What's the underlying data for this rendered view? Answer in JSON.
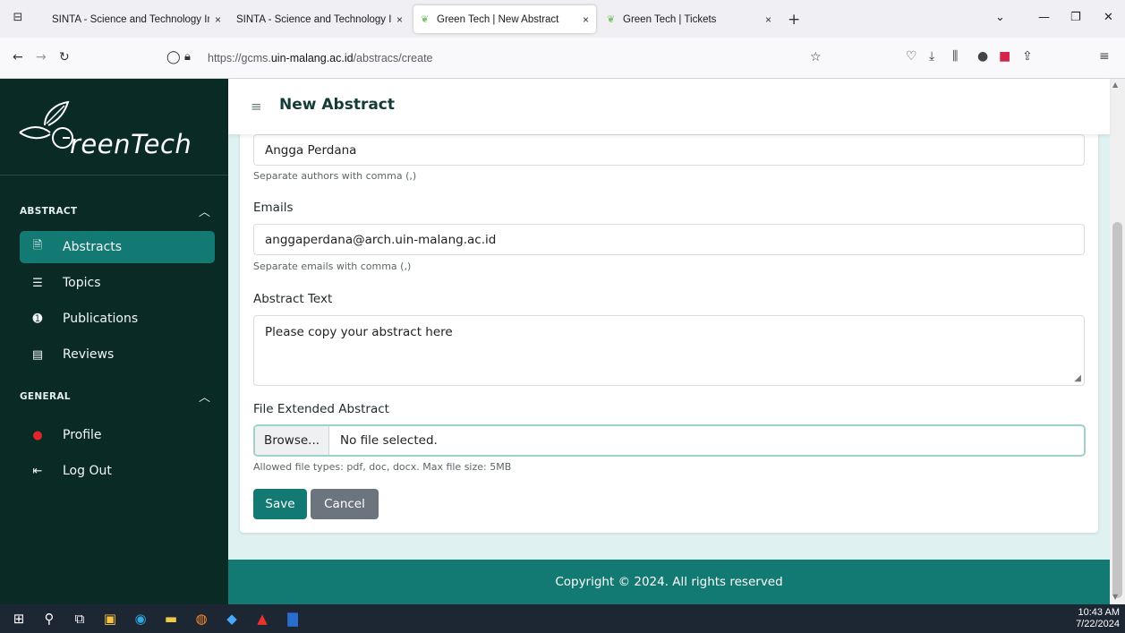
{
  "browser": {
    "tabs": [
      {
        "title": "SINTA - Science and Technology Ind",
        "active": false
      },
      {
        "title": "SINTA - Science and Technology Ind",
        "active": false
      },
      {
        "title": "Green Tech | New Abstract",
        "active": true
      },
      {
        "title": "Green Tech | Tickets",
        "active": false
      }
    ],
    "close_glyph": "×",
    "new_tab_glyph": "+",
    "url_prefix": "https://gcms.",
    "url_domain": "uin-malang.ac.id",
    "url_path": "/abstracs/create"
  },
  "sidebar": {
    "logo_text": "reenTech",
    "sections": [
      {
        "label": "ABSTRACT",
        "items": [
          {
            "label": "Abstracts",
            "icon": "document-icon",
            "active": true
          },
          {
            "label": "Topics",
            "icon": "list-icon",
            "active": false
          },
          {
            "label": "Publications",
            "icon": "upload-circle-icon",
            "active": false
          },
          {
            "label": "Reviews",
            "icon": "message-icon",
            "active": false
          }
        ]
      },
      {
        "label": "GENERAL",
        "items": [
          {
            "label": "Profile",
            "icon": "alert-circle-icon",
            "active": false
          },
          {
            "label": "Log Out",
            "icon": "logout-icon",
            "active": false
          }
        ]
      }
    ]
  },
  "header": {
    "title": "New Abstract"
  },
  "form": {
    "authors_value": "Angga Perdana",
    "authors_help": "Separate authors with comma (,)",
    "emails_label": "Emails",
    "emails_value": "anggaperdana@arch.uin-malang.ac.id",
    "emails_help": "Separate emails with comma (,)",
    "abstract_label": "Abstract Text",
    "abstract_placeholder": "Please copy your abstract here",
    "file_label": "File Extended Abstract",
    "browse_label": "Browse...",
    "file_status": "No file selected.",
    "file_help": "Allowed file types: pdf, doc, docx. Max file size: 5MB",
    "save_label": "Save",
    "cancel_label": "Cancel"
  },
  "footer": {
    "text": "Copyright © 2024. All rights reserved"
  },
  "taskbar": {
    "time": "10:43 AM",
    "date": "7/22/2024"
  },
  "colors": {
    "sidebar_bg": "#0a2a26",
    "accent": "#127a72",
    "cancel": "#6c757d"
  }
}
